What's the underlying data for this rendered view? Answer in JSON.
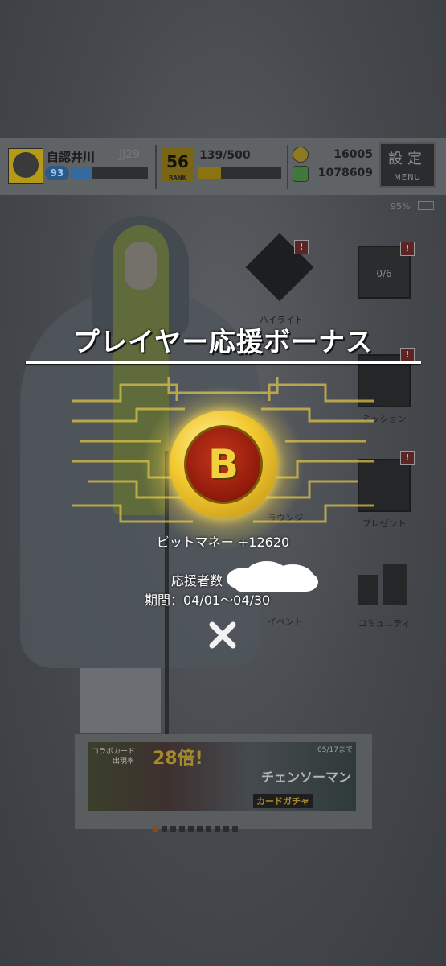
{
  "header": {
    "player_name": "自認井川",
    "player_id": "JJ29",
    "level": "93",
    "level_progress": 0.28,
    "rank": "56",
    "rank_label": "RANK",
    "stamina": "139/500",
    "stamina_progress": 0.28,
    "coins": "16005",
    "bit_money": "1078609",
    "settings_label": "設定",
    "settings_sub": "MENU",
    "battery": "95%"
  },
  "menu": {
    "highlight": "ハイライト",
    "mission": "ミッション",
    "present": "プレゼント",
    "event": "イベント",
    "community": "コミュニティ",
    "lounge": "ラウンジ",
    "calendar_count": "0/6",
    "badge": "!"
  },
  "banner": {
    "promo1": "コラボカード",
    "promo2": "出現率",
    "multiplier": "28倍!",
    "until": "05/17まで",
    "title": "チェンソーマン",
    "gacha": "カードガチャ",
    "page_count": 10,
    "active_page": 1
  },
  "bonus": {
    "title": "プレイヤー応援ボーナス",
    "coin_symbol": "B",
    "reward": "ビットマネー +12620",
    "supporter": "応援者数",
    "period": "期間：04/01～04/30"
  },
  "colors": {
    "accent_gold": "#f2c830",
    "coin_red": "#8e1a0a",
    "overlay_text": "#ffffff"
  },
  "icons": {
    "close": "close-icon",
    "coin": "bit-coin-icon"
  }
}
